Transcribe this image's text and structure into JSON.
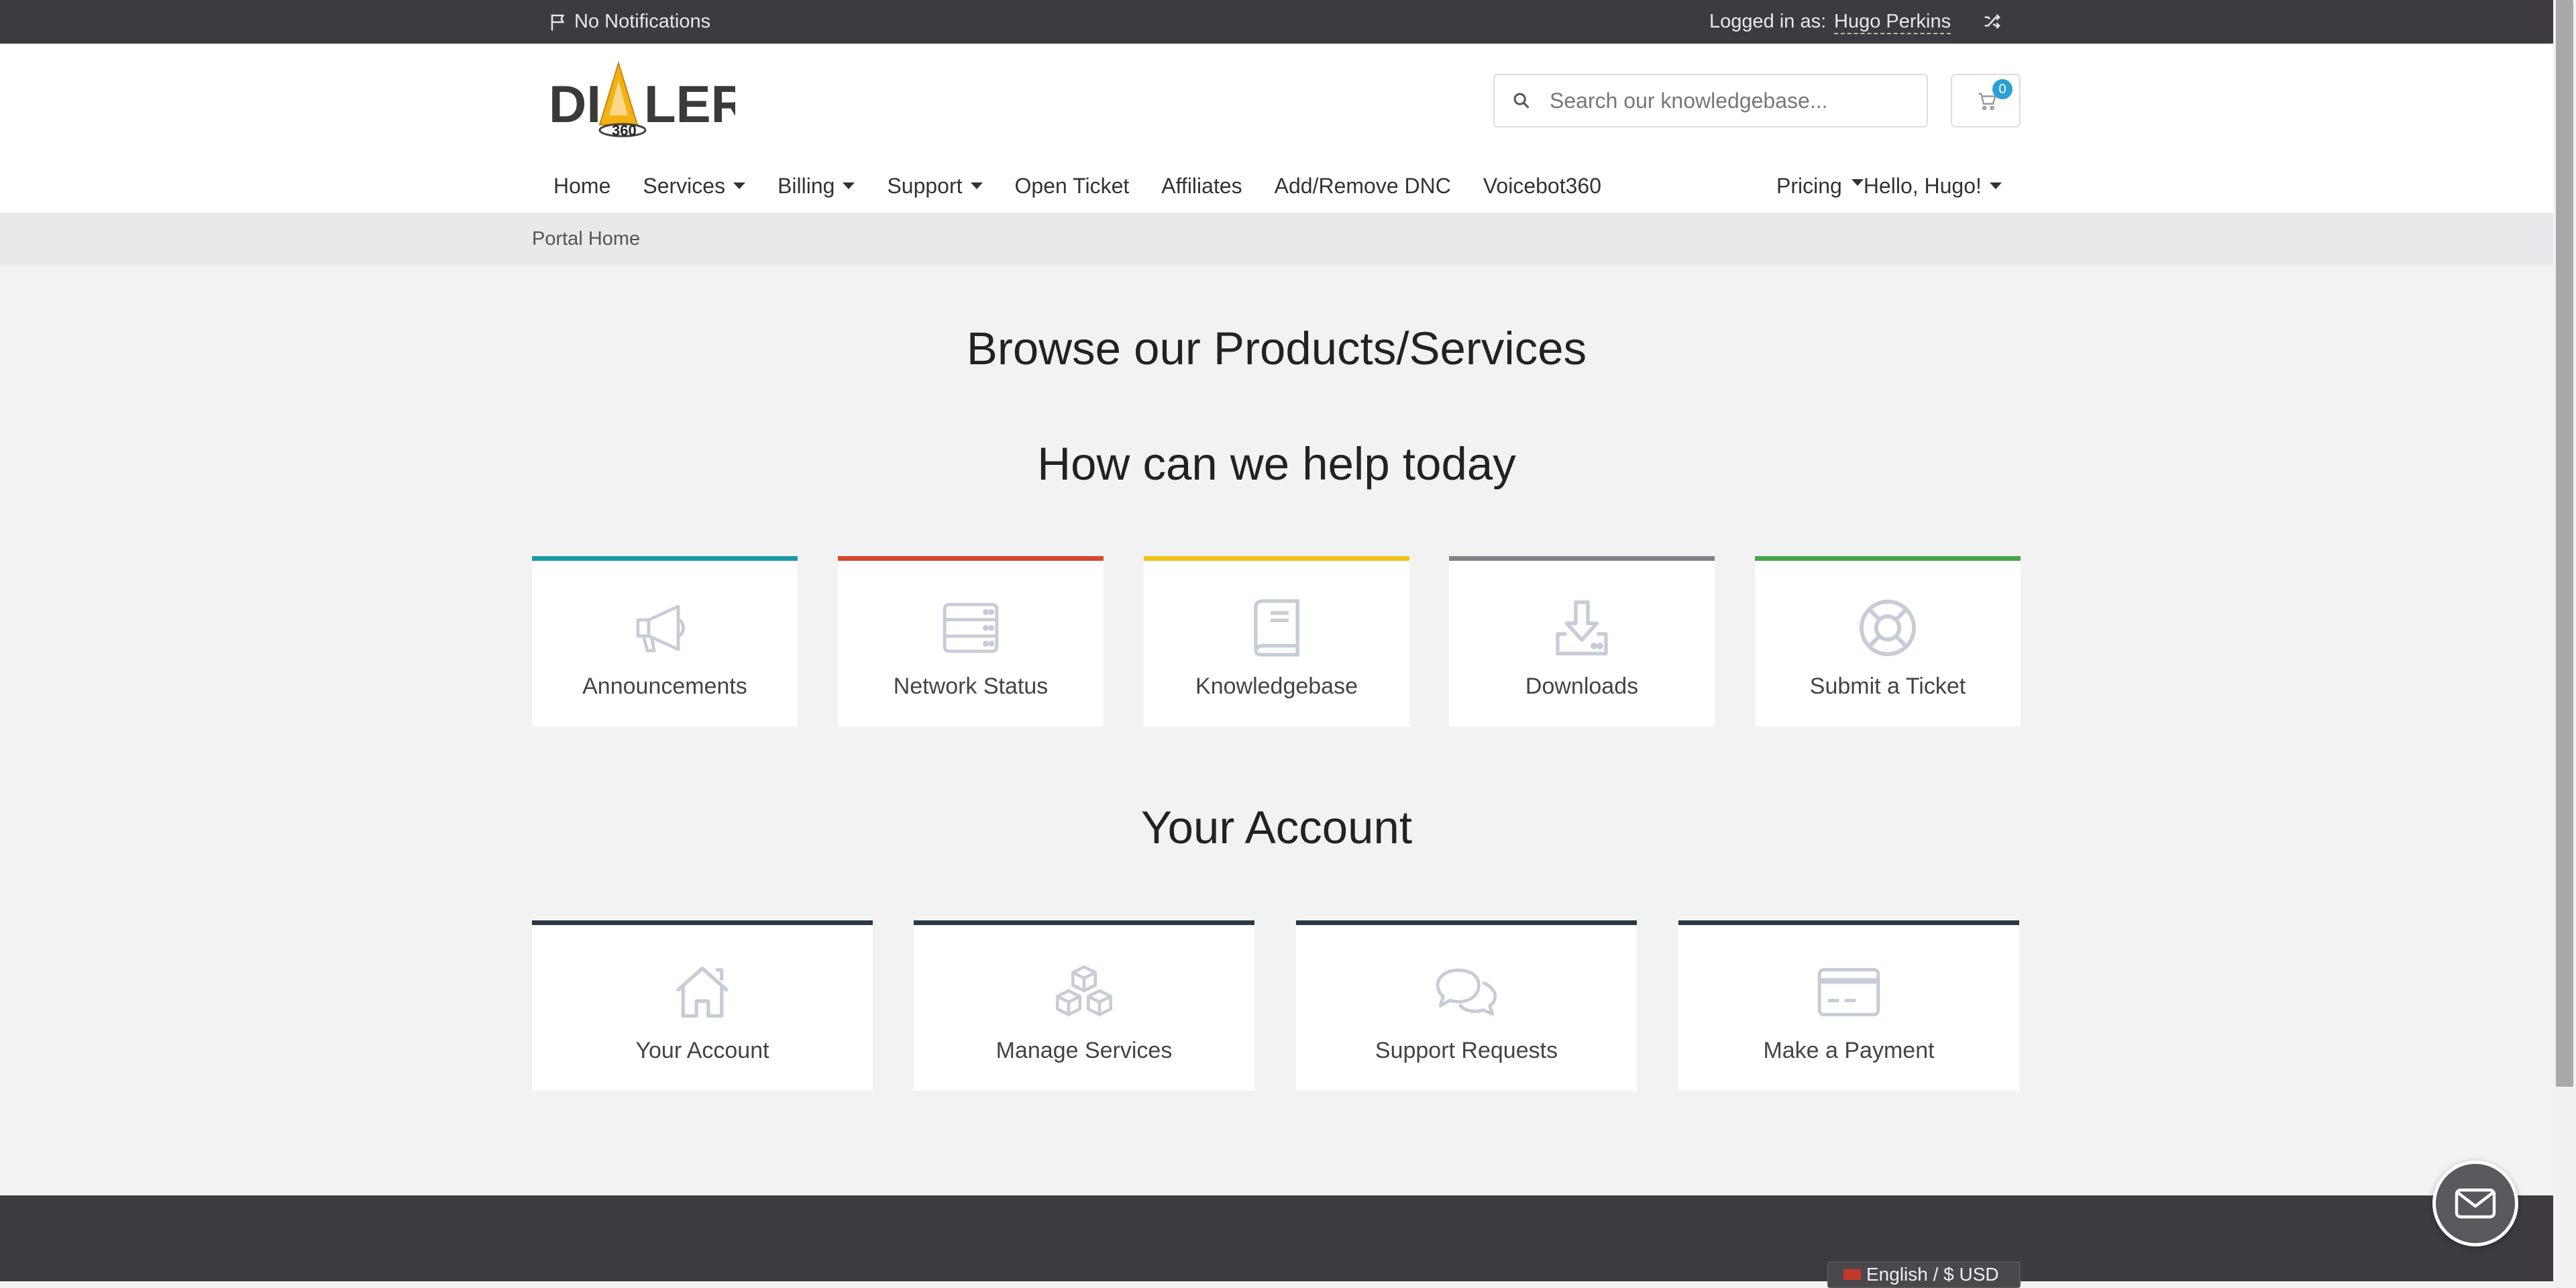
{
  "topbar": {
    "notifications": "No Notifications",
    "logged_in_label": "Logged in as:",
    "user_name": "Hugo Perkins"
  },
  "logo": {
    "text_left": "DI",
    "text_right": "LER",
    "badge": "360"
  },
  "search": {
    "placeholder": "Search our knowledgebase..."
  },
  "cart": {
    "count": "0"
  },
  "nav": {
    "left": [
      {
        "label": "Home",
        "dropdown": false
      },
      {
        "label": "Services",
        "dropdown": true
      },
      {
        "label": "Billing",
        "dropdown": true
      },
      {
        "label": "Support",
        "dropdown": true
      },
      {
        "label": "Open Ticket",
        "dropdown": false
      },
      {
        "label": "Affiliates",
        "dropdown": false
      },
      {
        "label": "Add/Remove DNC",
        "dropdown": false
      },
      {
        "label": "Voicebot360",
        "dropdown": false
      }
    ],
    "right": [
      {
        "label": "Pricing",
        "dropdown": true
      },
      {
        "label": "Hello, Hugo!",
        "dropdown": true
      }
    ]
  },
  "breadcrumb": "Portal Home",
  "headings": {
    "browse": "Browse our Products/Services",
    "help": "How can we help today",
    "account": "Your Account"
  },
  "help_cards": [
    {
      "label": "Announcements",
      "icon": "megaphone-icon",
      "color": "#1a9aa6"
    },
    {
      "label": "Network Status",
      "icon": "server-icon",
      "color": "#d8472b"
    },
    {
      "label": "Knowledgebase",
      "icon": "book-icon",
      "color": "#f2c21b"
    },
    {
      "label": "Downloads",
      "icon": "download-icon",
      "color": "#848189"
    },
    {
      "label": "Submit a Ticket",
      "icon": "lifebuoy-icon",
      "color": "#49a54a"
    }
  ],
  "account_cards": [
    {
      "label": "Your Account",
      "icon": "home-icon",
      "color": "#2e3543"
    },
    {
      "label": "Manage Services",
      "icon": "cubes-icon",
      "color": "#2e3543"
    },
    {
      "label": "Support Requests",
      "icon": "comments-icon",
      "color": "#2e3543"
    },
    {
      "label": "Make a Payment",
      "icon": "credit-card-icon",
      "color": "#2e3543"
    }
  ],
  "footer": {
    "language": "English / $ USD"
  }
}
